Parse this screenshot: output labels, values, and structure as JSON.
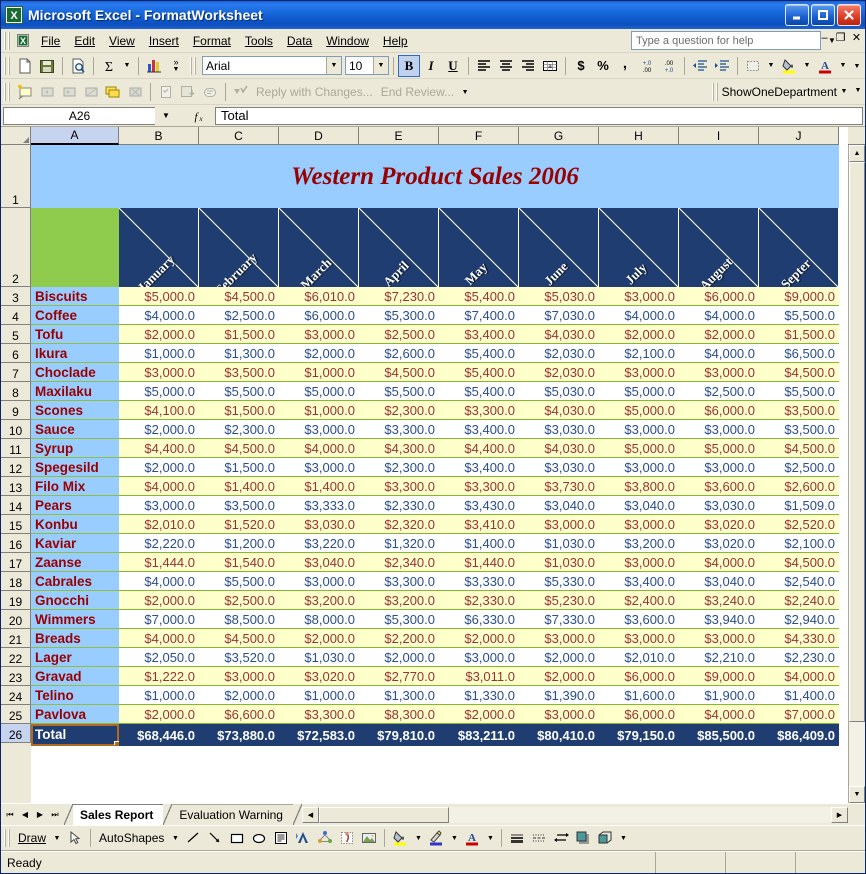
{
  "window": {
    "title": "Microsoft Excel - FormatWorksheet",
    "app_icon": "excel-icon",
    "minimize_label": "_",
    "maximize_label": "□",
    "close_label": "✕"
  },
  "menu": {
    "items": [
      "File",
      "Edit",
      "View",
      "Insert",
      "Format",
      "Tools",
      "Data",
      "Window",
      "Help"
    ],
    "ask_placeholder": "Type a question for help",
    "mdi": [
      "–",
      "❐",
      "✕"
    ]
  },
  "toolbar": {
    "icons": [
      "new-icon",
      "save-icon",
      "print-preview-icon",
      "autosum-icon",
      "chart-wizard-icon"
    ],
    "font_name": "Arial",
    "font_size": "10",
    "bold_label": "B",
    "italic_label": "I",
    "underline_label": "U",
    "align_left": "align-left-icon",
    "align_center": "align-center-icon",
    "align_right": "align-right-icon",
    "merge_center": "merge-center-icon",
    "currency_label": "$",
    "percent_label": "%",
    "comma_label": ",",
    "inc_dec": "+.0",
    "dec_dec": ".00",
    "dec_indent": "decrease-indent-icon",
    "inc_indent": "increase-indent-icon",
    "borders": "borders-icon",
    "fill_color": "fill-color-icon",
    "font_color": "font-color-icon",
    "overflow_label": "»"
  },
  "reviewing_toolbar": {
    "reply_label": "Reply with Changes...",
    "end_review_label": "End Review...",
    "macro_name": "ShowOneDepartment"
  },
  "formula_bar": {
    "name_box": "A26",
    "fx_label": "fx",
    "value": "Total"
  },
  "grid": {
    "columns": [
      "A",
      "B",
      "C",
      "D",
      "E",
      "F",
      "G",
      "H",
      "I",
      "J"
    ],
    "selected_column": "A",
    "selected_row": "26",
    "row_numbers": [
      "1",
      "2",
      "3",
      "4",
      "5",
      "6",
      "7",
      "8",
      "9",
      "10",
      "11",
      "12",
      "13",
      "14",
      "15",
      "16",
      "17",
      "18",
      "19",
      "20",
      "21",
      "22",
      "23",
      "24",
      "25",
      "26"
    ],
    "sheet_title": "Western Product Sales 2006",
    "months": [
      "January",
      "February",
      "March",
      "April",
      "May",
      "June",
      "July",
      "August",
      "Septer"
    ],
    "corner_label": "",
    "rows": [
      {
        "product": "Biscuits",
        "values": [
          "$5,000.0",
          "$4,500.0",
          "$6,010.0",
          "$7,230.0",
          "$5,400.0",
          "$5,030.0",
          "$3,000.0",
          "$6,000.0",
          "$9,000.0"
        ]
      },
      {
        "product": "Coffee",
        "values": [
          "$4,000.0",
          "$2,500.0",
          "$6,000.0",
          "$5,300.0",
          "$7,400.0",
          "$7,030.0",
          "$4,000.0",
          "$4,000.0",
          "$5,500.0"
        ]
      },
      {
        "product": "Tofu",
        "values": [
          "$2,000.0",
          "$1,500.0",
          "$3,000.0",
          "$2,500.0",
          "$3,400.0",
          "$4,030.0",
          "$2,000.0",
          "$2,000.0",
          "$1,500.0"
        ]
      },
      {
        "product": "Ikura",
        "values": [
          "$1,000.0",
          "$1,300.0",
          "$2,000.0",
          "$2,600.0",
          "$5,400.0",
          "$2,030.0",
          "$2,100.0",
          "$4,000.0",
          "$6,500.0"
        ]
      },
      {
        "product": "Choclade",
        "values": [
          "$3,000.0",
          "$3,500.0",
          "$1,000.0",
          "$4,500.0",
          "$5,400.0",
          "$2,030.0",
          "$3,000.0",
          "$3,000.0",
          "$4,500.0"
        ]
      },
      {
        "product": "Maxilaku",
        "values": [
          "$5,000.0",
          "$5,500.0",
          "$5,000.0",
          "$5,500.0",
          "$5,400.0",
          "$5,030.0",
          "$5,000.0",
          "$2,500.0",
          "$5,500.0"
        ]
      },
      {
        "product": "Scones",
        "values": [
          "$4,100.0",
          "$1,500.0",
          "$1,000.0",
          "$2,300.0",
          "$3,300.0",
          "$4,030.0",
          "$5,000.0",
          "$6,000.0",
          "$3,500.0"
        ]
      },
      {
        "product": "Sauce",
        "values": [
          "$2,000.0",
          "$2,300.0",
          "$3,000.0",
          "$3,300.0",
          "$3,400.0",
          "$3,030.0",
          "$3,000.0",
          "$3,000.0",
          "$3,500.0"
        ]
      },
      {
        "product": "Syrup",
        "values": [
          "$4,400.0",
          "$4,500.0",
          "$4,000.0",
          "$4,300.0",
          "$4,400.0",
          "$4,030.0",
          "$5,000.0",
          "$5,000.0",
          "$4,500.0"
        ]
      },
      {
        "product": "Spegesild",
        "values": [
          "$2,000.0",
          "$1,500.0",
          "$3,000.0",
          "$2,300.0",
          "$3,400.0",
          "$3,030.0",
          "$3,000.0",
          "$3,000.0",
          "$2,500.0"
        ]
      },
      {
        "product": "Filo Mix",
        "values": [
          "$4,000.0",
          "$1,400.0",
          "$1,400.0",
          "$3,300.0",
          "$3,300.0",
          "$3,730.0",
          "$3,800.0",
          "$3,600.0",
          "$2,600.0"
        ]
      },
      {
        "product": "Pears",
        "values": [
          "$3,000.0",
          "$3,500.0",
          "$3,333.0",
          "$2,330.0",
          "$3,430.0",
          "$3,040.0",
          "$3,040.0",
          "$3,030.0",
          "$1,509.0"
        ]
      },
      {
        "product": "Konbu",
        "values": [
          "$2,010.0",
          "$1,520.0",
          "$3,030.0",
          "$2,320.0",
          "$3,410.0",
          "$3,000.0",
          "$3,000.0",
          "$3,020.0",
          "$2,520.0"
        ]
      },
      {
        "product": "Kaviar",
        "values": [
          "$2,220.0",
          "$1,200.0",
          "$3,220.0",
          "$1,320.0",
          "$1,400.0",
          "$1,030.0",
          "$3,200.0",
          "$3,020.0",
          "$2,100.0"
        ]
      },
      {
        "product": "Zaanse",
        "values": [
          "$1,444.0",
          "$1,540.0",
          "$3,040.0",
          "$2,340.0",
          "$1,440.0",
          "$1,030.0",
          "$3,000.0",
          "$4,000.0",
          "$4,500.0"
        ]
      },
      {
        "product": "Cabrales",
        "values": [
          "$4,000.0",
          "$5,500.0",
          "$3,000.0",
          "$3,300.0",
          "$3,330.0",
          "$5,330.0",
          "$3,400.0",
          "$3,040.0",
          "$2,540.0"
        ]
      },
      {
        "product": "Gnocchi",
        "values": [
          "$2,000.0",
          "$2,500.0",
          "$3,200.0",
          "$3,200.0",
          "$2,330.0",
          "$5,230.0",
          "$2,400.0",
          "$3,240.0",
          "$2,240.0"
        ]
      },
      {
        "product": "Wimmers",
        "values": [
          "$7,000.0",
          "$8,500.0",
          "$8,000.0",
          "$5,300.0",
          "$6,330.0",
          "$7,330.0",
          "$3,600.0",
          "$3,940.0",
          "$2,940.0"
        ]
      },
      {
        "product": "Breads",
        "values": [
          "$4,000.0",
          "$4,500.0",
          "$2,000.0",
          "$2,200.0",
          "$2,000.0",
          "$3,000.0",
          "$3,000.0",
          "$3,000.0",
          "$4,330.0"
        ]
      },
      {
        "product": "Lager",
        "values": [
          "$2,050.0",
          "$3,520.0",
          "$1,030.0",
          "$2,000.0",
          "$3,000.0",
          "$2,000.0",
          "$2,010.0",
          "$2,210.0",
          "$2,230.0"
        ]
      },
      {
        "product": "Gravad",
        "values": [
          "$1,222.0",
          "$3,000.0",
          "$3,020.0",
          "$2,770.0",
          "$3,011.0",
          "$2,000.0",
          "$6,000.0",
          "$9,000.0",
          "$4,000.0"
        ]
      },
      {
        "product": "Telino",
        "values": [
          "$1,000.0",
          "$2,000.0",
          "$1,000.0",
          "$1,300.0",
          "$1,330.0",
          "$1,390.0",
          "$1,600.0",
          "$1,900.0",
          "$1,400.0"
        ]
      },
      {
        "product": "Pavlova",
        "values": [
          "$2,000.0",
          "$6,600.0",
          "$3,300.0",
          "$8,300.0",
          "$2,000.0",
          "$3,000.0",
          "$6,000.0",
          "$4,000.0",
          "$7,000.0"
        ]
      }
    ],
    "total_row": {
      "label": "Total",
      "values": [
        "$68,446.0",
        "$73,880.0",
        "$72,583.0",
        "$79,810.0",
        "$83,211.0",
        "$80,410.0",
        "$79,150.0",
        "$85,500.0",
        "$86,409.0"
      ]
    }
  },
  "sheet_tabs": {
    "nav": [
      "⏮",
      "◀",
      "▶",
      "⏭"
    ],
    "tabs": [
      {
        "label": "Sales Report",
        "active": true
      },
      {
        "label": "Evaluation Warning",
        "active": false
      }
    ]
  },
  "drawing_toolbar": {
    "draw_label": "Draw",
    "select_icon": "select-arrow-icon",
    "autoshapes_label": "AutoShapes",
    "icons": [
      "line-icon",
      "arrow-icon",
      "rectangle-icon",
      "oval-icon",
      "textbox-icon",
      "wordart-icon",
      "diagram-icon",
      "clipart-icon",
      "picture-icon",
      "fill-color-icon",
      "line-color-icon",
      "font-color-icon",
      "line-style-icon",
      "dash-style-icon",
      "arrow-style-icon",
      "shadow-icon",
      "3d-icon"
    ]
  },
  "status_bar": {
    "message": "Ready"
  }
}
